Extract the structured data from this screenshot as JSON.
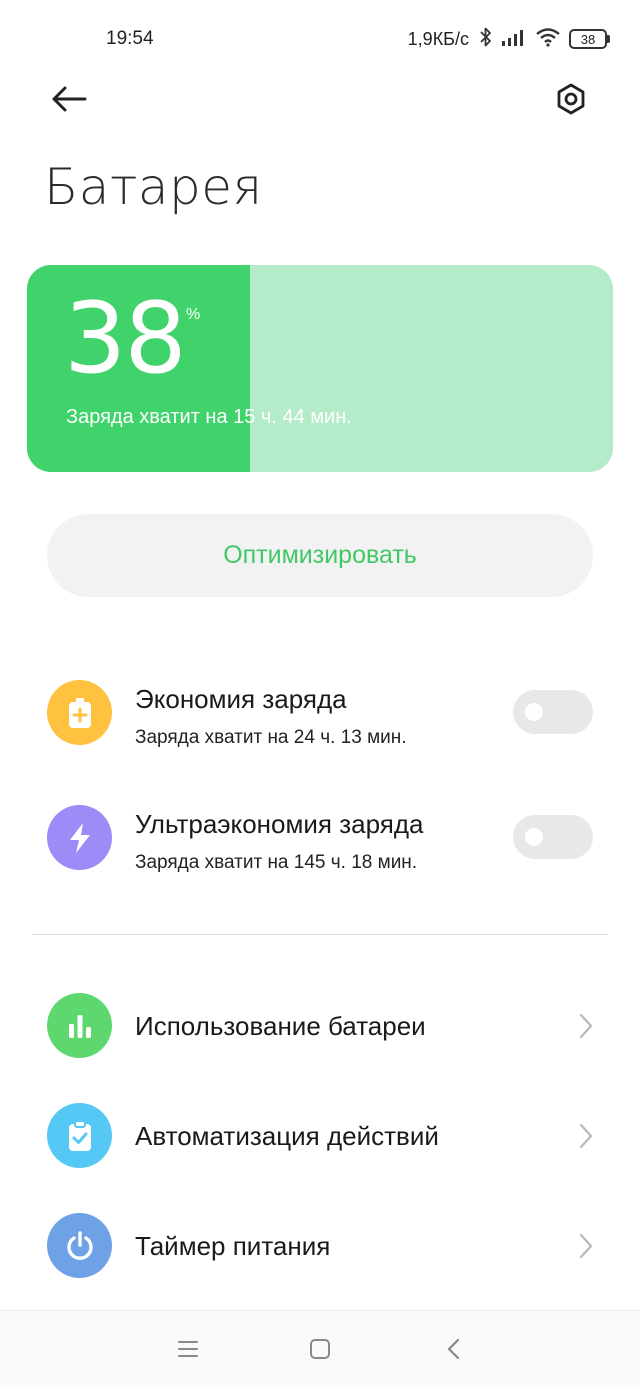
{
  "status_bar": {
    "time": "19:54",
    "network_speed": "1,9КБ/с",
    "battery_level": "38",
    "icons": [
      "bluetooth-icon",
      "signal-icon",
      "wifi-icon",
      "battery-icon"
    ]
  },
  "header": {
    "back_icon": "back-arrow-icon",
    "settings_icon": "settings-hexagon-icon",
    "title": "Батарея"
  },
  "battery": {
    "percent": "38",
    "percent_sign": "%",
    "remaining": "Заряда хватит на 15 ч. 44 мин.",
    "level_fraction": 0.38,
    "fill_color": "#41d36b",
    "track_color": "#b4ebc8"
  },
  "optimize": {
    "label": "Оптимизировать",
    "color": "#41c866"
  },
  "modes": [
    {
      "title": "Экономия заряда",
      "subtitle": "Заряда хватит на 24 ч. 13 мин.",
      "icon": "battery-saver-icon",
      "icon_color": "#ffc240",
      "enabled": false
    },
    {
      "title": "Ультраэкономия заряда",
      "subtitle": "Заряда хватит на 145 ч. 18 мин.",
      "icon": "lightning-icon",
      "icon_color": "#9b8cf7",
      "enabled": false
    }
  ],
  "nav_items": [
    {
      "label": "Использование батареи",
      "icon": "bar-chart-icon",
      "icon_color": "#5ed86e"
    },
    {
      "label": "Автоматизация действий",
      "icon": "clipboard-check-icon",
      "icon_color": "#55c8f5"
    },
    {
      "label": "Таймер питания",
      "icon": "power-icon",
      "icon_color": "#6fa1e6"
    }
  ],
  "system_nav": [
    "menu-icon",
    "home-icon",
    "back-icon"
  ]
}
